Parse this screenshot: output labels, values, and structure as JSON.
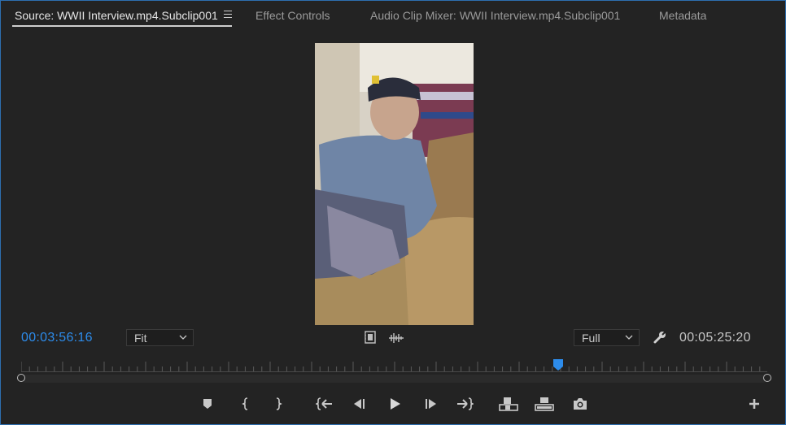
{
  "tabs": [
    {
      "label": "Source: WWII Interview.mp4.Subclip001",
      "active": true
    },
    {
      "label": "Effect Controls",
      "active": false
    },
    {
      "label": "Audio Clip Mixer: WWII Interview.mp4.Subclip001",
      "active": false
    },
    {
      "label": "Metadata",
      "active": false
    }
  ],
  "timecode_current": "00:03:56:16",
  "timecode_duration": "00:05:25:20",
  "zoom_select": {
    "value": "Fit"
  },
  "resolution_select": {
    "value": "Full"
  },
  "playhead_fraction": 0.72,
  "colors": {
    "accent": "#2d8ceb",
    "panel_border": "#2d6fb0",
    "background": "#232323"
  },
  "transport_icons": [
    "add-marker-icon",
    "mark-in-icon",
    "mark-out-icon",
    "go-to-in-icon",
    "step-back-icon",
    "play-icon",
    "step-forward-icon",
    "go-to-out-icon",
    "insert-icon",
    "overwrite-icon",
    "export-frame-icon",
    "button-editor-icon"
  ]
}
